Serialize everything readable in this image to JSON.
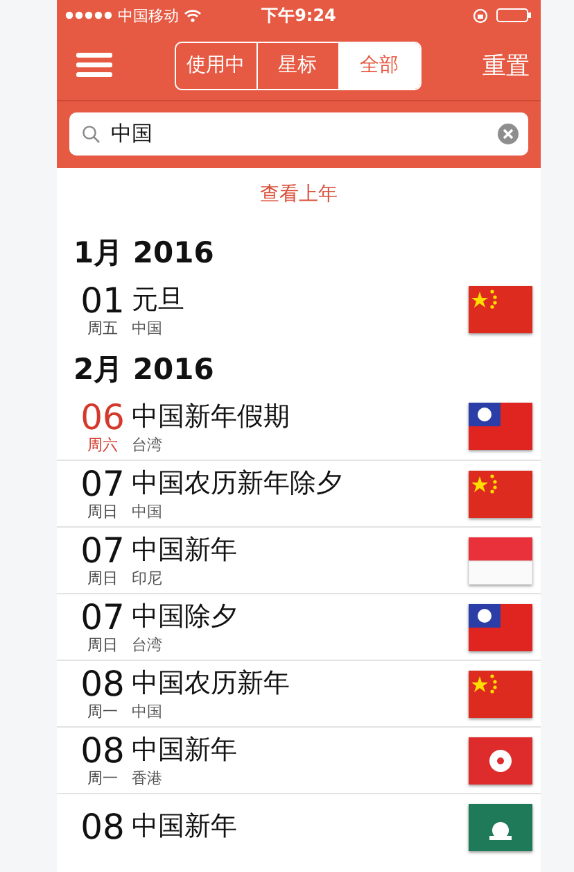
{
  "status_bar": {
    "carrier": "中国移动",
    "time": "下午9:24"
  },
  "nav_bar": {
    "tabs": [
      {
        "label": "使用中",
        "selected": false
      },
      {
        "label": "星标",
        "selected": false
      },
      {
        "label": "全部",
        "selected": true
      }
    ],
    "reset": "重置"
  },
  "search": {
    "value": "中国"
  },
  "previous_year": "查看上年",
  "sections": [
    {
      "title": "1月 2016",
      "rows": [
        {
          "day": "01",
          "name": "元旦",
          "weekday": "周五",
          "country": "中国",
          "highlighted": false,
          "kind": "china"
        }
      ]
    },
    {
      "title": "2月 2016",
      "rows": [
        {
          "day": "06",
          "name": "中国新年假期",
          "weekday": "周六",
          "country": "台湾",
          "highlighted": true,
          "kind": "taiwan"
        },
        {
          "day": "07",
          "name": "中国农历新年除夕",
          "weekday": "周日",
          "country": "中国",
          "highlighted": false,
          "kind": "china"
        },
        {
          "day": "07",
          "name": "中国新年",
          "weekday": "周日",
          "country": "印尼",
          "highlighted": false,
          "kind": "indonesia"
        },
        {
          "day": "07",
          "name": "中国除夕",
          "weekday": "周日",
          "country": "台湾",
          "highlighted": false,
          "kind": "taiwan"
        },
        {
          "day": "08",
          "name": "中国农历新年",
          "weekday": "周一",
          "country": "中国",
          "highlighted": false,
          "kind": "china"
        },
        {
          "day": "08",
          "name": "中国新年",
          "weekday": "周一",
          "country": "香港",
          "highlighted": false,
          "kind": "hongkong"
        },
        {
          "day": "08",
          "name": "中国新年",
          "highlighted": false,
          "kind": "macau"
        }
      ]
    }
  ]
}
